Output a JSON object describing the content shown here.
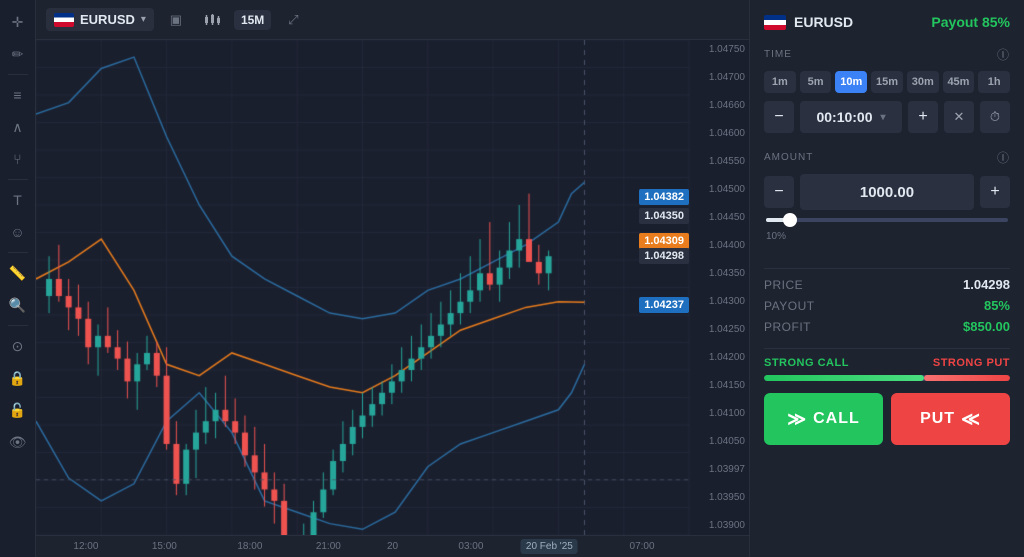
{
  "header": {
    "asset": "EURUSD",
    "chart_type_icon": "candlestick",
    "timeframe": "15M",
    "expand_icon": "expand"
  },
  "chart": {
    "price_labels": [
      "1.04750",
      "1.04700",
      "1.04660",
      "1.04600",
      "1.04550",
      "1.04500",
      "1.04450",
      "1.04400",
      "1.04350",
      "1.04300",
      "1.04250",
      "1.04200",
      "1.04150",
      "1.04100",
      "1.04050",
      "1.03997",
      "1.03950",
      "1.03900"
    ],
    "price_tag_1": "1.04382",
    "price_tag_2": "1.04350",
    "price_tag_3": "1.04309",
    "price_tag_4": "1.04298",
    "price_tag_5": "1.04237",
    "xaxis": [
      "12:00",
      "15:00",
      "18:00",
      "21:00",
      "20",
      "03:00",
      "20 Feb '25",
      "07:00"
    ],
    "date_highlight": "20 Feb '25"
  },
  "panel": {
    "asset": "EURUSD",
    "payout": "Payout 85%",
    "time_section_label": "TIME",
    "time_buttons": [
      "1m",
      "5m",
      "10m",
      "15m",
      "30m",
      "45m",
      "1h"
    ],
    "active_time_btn": "10m",
    "time_value": "00:10:00",
    "amount_section_label": "AMOUNT",
    "amount_value": "1000.00",
    "slider_pct": "10%",
    "price_label": "PRICE",
    "price_value": "1.04298",
    "payout_label": "PAYOUT",
    "payout_value": "85%",
    "profit_label": "PROFIT",
    "profit_value": "$850.00",
    "strong_call_label": "STRONG CALL",
    "strong_put_label": "STRONG PUT",
    "call_btn_label": "CALL",
    "put_btn_label": "PUT"
  },
  "icons": {
    "monitor": "▣",
    "bar_chart": "▐▌",
    "expand": "⤢",
    "plus": "+",
    "minus": "−",
    "cross": "✕",
    "lock": "🔒",
    "clock": "⏱",
    "info": "ⓘ",
    "chevron_down": "▾",
    "call_arrows": "≫",
    "put_arrows": "≪"
  }
}
